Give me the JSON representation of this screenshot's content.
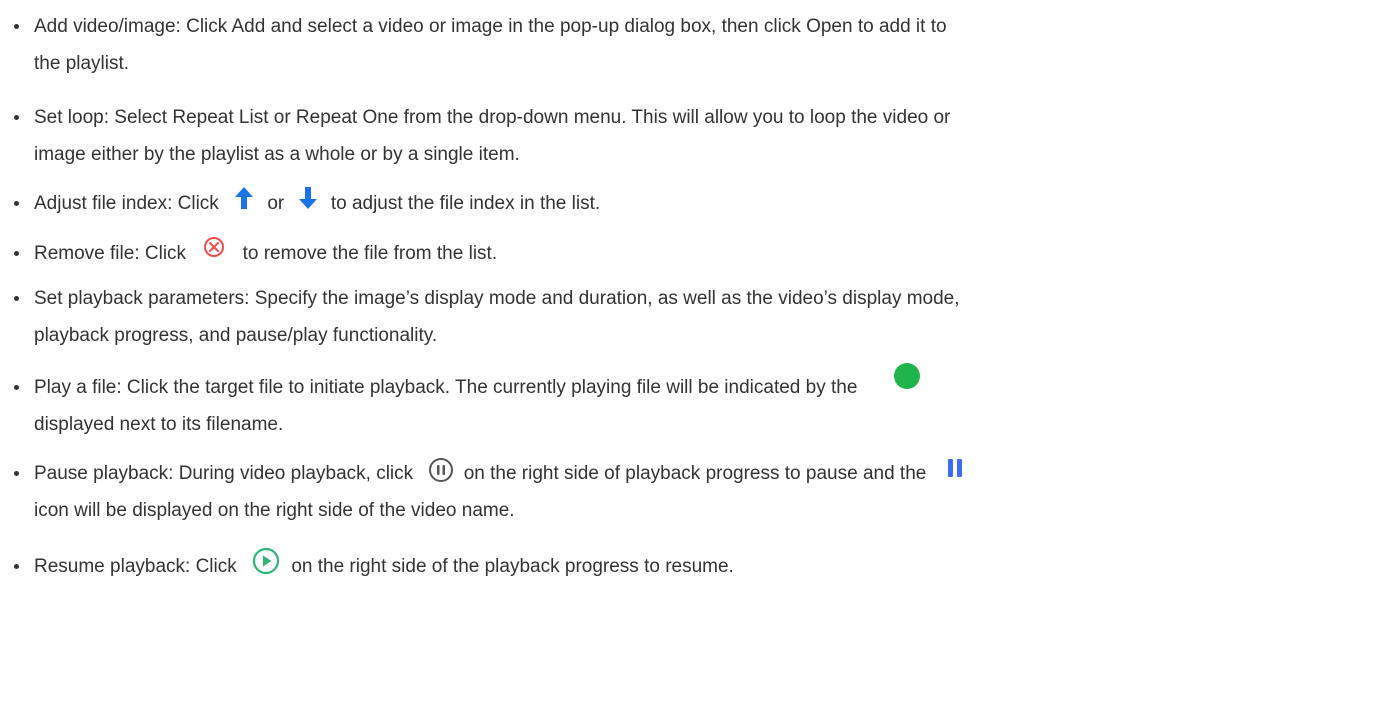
{
  "items": [
    {
      "line1": "Add video/image: Click Add and select a video or image in the pop-up dialog box, then click Open to add it to",
      "line2": "the playlist."
    },
    {
      "line1": "Set loop: Select Repeat List or Repeat One from the drop-down menu. This will allow you to loop the video or",
      "line2": "image either by the playlist as a whole or by a single item."
    },
    {
      "before": "Adjust file index: Click",
      "middle": "or",
      "after": "to adjust the file index in the list."
    },
    {
      "before": "Remove file: Click",
      "after": "to remove the file from the list."
    },
    {
      "line1": "Set playback parameters: Specify the image’s display mode and duration, as well as the video’s display mode,",
      "line2": "playback progress, and pause/play functionality."
    },
    {
      "before": "Play a file: Click the target file to initiate playback. The currently playing file will be indicated by the",
      "line2": "displayed next to its filename."
    },
    {
      "before": "Pause playback: During video playback, click",
      "middle": "on the right side of playback progress to pause and the",
      "line2": "icon will be displayed on the right side of the video name."
    },
    {
      "before": "Resume playback: Click",
      "after": "on the right side of the playback progress to resume."
    }
  ],
  "icons": {
    "arrow_up": "arrow-up-icon",
    "arrow_down": "arrow-down-icon",
    "remove": "remove-circle-icon",
    "playing_dot": "playing-dot-icon",
    "pause_circle": "pause-circle-icon",
    "pause_bars": "pause-bars-icon",
    "play_circle": "play-circle-icon"
  },
  "colors": {
    "text": "#333333",
    "arrow_blue": "#1a73e8",
    "remove_red": "#f0504a",
    "playing_green": "#1fb54a",
    "pause_gray": "#555555",
    "pause_bars_blue": "#3a6ff0",
    "play_green": "#2bb673"
  }
}
